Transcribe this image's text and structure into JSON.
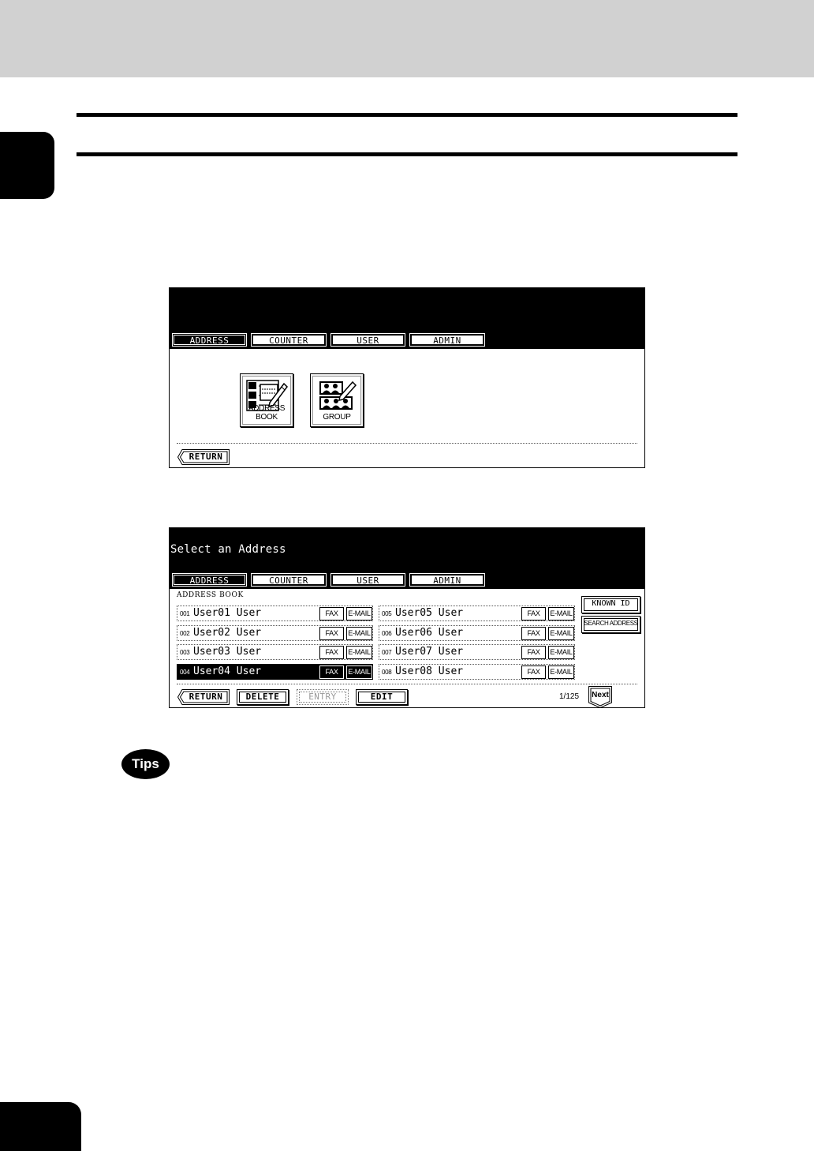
{
  "screen1": {
    "tabs": [
      {
        "label": "ADDRESS",
        "active": true
      },
      {
        "label": "COUNTER",
        "active": false
      },
      {
        "label": "USER",
        "active": false
      },
      {
        "label": "ADMIN",
        "active": false
      }
    ],
    "buttons": {
      "address_book": "ADDRESS BOOK",
      "group": "GROUP"
    },
    "return_label": "RETURN"
  },
  "screen2": {
    "title": "Select an Address",
    "tabs": [
      {
        "label": "ADDRESS",
        "active": true
      },
      {
        "label": "COUNTER",
        "active": false
      },
      {
        "label": "USER",
        "active": false
      },
      {
        "label": "ADMIN",
        "active": false
      }
    ],
    "section_label": "ADDRESS BOOK",
    "entries": [
      {
        "num": "001",
        "name": "User01 User",
        "fax": "FAX",
        "email": "E-MAIL",
        "selected": false
      },
      {
        "num": "002",
        "name": "User02 User",
        "fax": "FAX",
        "email": "E-MAIL",
        "selected": false
      },
      {
        "num": "003",
        "name": "User03 User",
        "fax": "FAX",
        "email": "E-MAIL",
        "selected": false
      },
      {
        "num": "004",
        "name": "User04 User",
        "fax": "FAX",
        "email": "E-MAIL",
        "selected": true
      },
      {
        "num": "005",
        "name": "User05 User",
        "fax": "FAX",
        "email": "E-MAIL",
        "selected": false
      },
      {
        "num": "006",
        "name": "User06 User",
        "fax": "FAX",
        "email": "E-MAIL",
        "selected": false
      },
      {
        "num": "007",
        "name": "User07 User",
        "fax": "FAX",
        "email": "E-MAIL",
        "selected": false
      },
      {
        "num": "008",
        "name": "User08 User",
        "fax": "FAX",
        "email": "E-MAIL",
        "selected": false
      }
    ],
    "known_id": "KNOWN ID",
    "search_address": "SEARCH ADDRESS",
    "bottom": {
      "return": "RETURN",
      "delete": "DELETE",
      "entry": "ENTRY",
      "edit": "EDIT"
    },
    "page": "1/125",
    "next": "Next"
  },
  "tips_label": "Tips"
}
